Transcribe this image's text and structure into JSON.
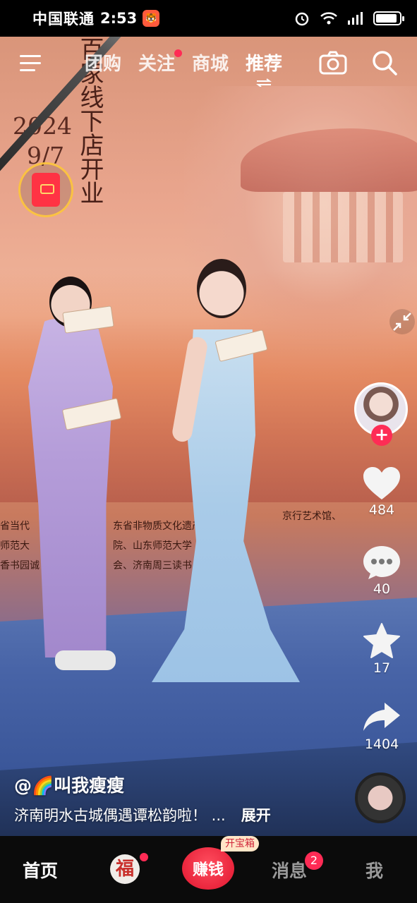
{
  "status_bar": {
    "carrier": "中国联通",
    "time": "2:53",
    "battery_level": 0.85
  },
  "top_nav": {
    "tabs": [
      {
        "label": "团购",
        "active": false
      },
      {
        "label": "关注",
        "active": false,
        "has_dot": true
      },
      {
        "label": "商城",
        "active": false
      },
      {
        "label": "推荐",
        "active": true
      }
    ]
  },
  "video": {
    "banner_vertical": "百家线下店开业",
    "banner_date_year": "2024",
    "banner_date_day": "9/7",
    "banner_left_lines": [
      "省当代",
      "师范大",
      "香书园诚"
    ],
    "banner_lines": [
      "东省非物质文化遗产",
      "院、山东师范大学",
      "会、济南周三读书"
    ],
    "banner_right_line": "京行艺术馆、"
  },
  "right_rail": {
    "like_count": "484",
    "comment_count": "40",
    "favorite_count": "17",
    "share_count": "1404"
  },
  "caption": {
    "author": "@🌈叫我瘦瘦",
    "text": "济南明水古城偶遇谭松韵啦！ ...",
    "expand_label": "展开"
  },
  "bottom_nav": {
    "home": "首页",
    "calendar_glyph": "福",
    "earn": "赚钱",
    "earn_tag": "开宝箱",
    "messages": "消息",
    "messages_badge": "2",
    "me": "我"
  }
}
